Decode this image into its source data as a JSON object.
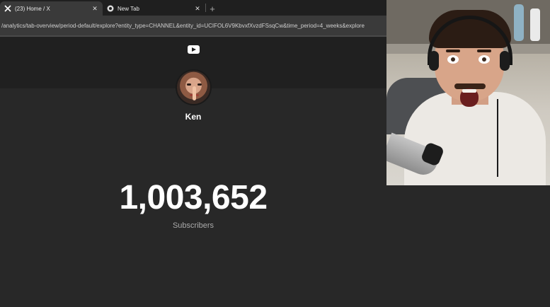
{
  "browser": {
    "tabs": [
      {
        "title": "(23) Home / X",
        "favicon": "x-logo-icon",
        "active": true
      },
      {
        "title": "New Tab",
        "favicon": "chrome-icon",
        "active": false
      }
    ],
    "new_tab_glyph": "+",
    "close_glyph": "✕",
    "url": "/analytics/tab-overview/period-default/explore?entity_type=CHANNEL&entity_id=UCIFOL6V9KbvxfXvzdFSsqCw&time_period=4_weeks&explore"
  },
  "page": {
    "logo": "youtube-play-icon",
    "channel_name": "Ken",
    "subscriber_count": "1,003,652",
    "subscriber_label": "Subscribers"
  },
  "webcam": {
    "description_icon": "webcam-overlay"
  },
  "colors": {
    "page_bg": "#282828",
    "header_bg": "#202020",
    "text_primary": "#ffffff",
    "text_secondary": "#aaaaaa"
  }
}
